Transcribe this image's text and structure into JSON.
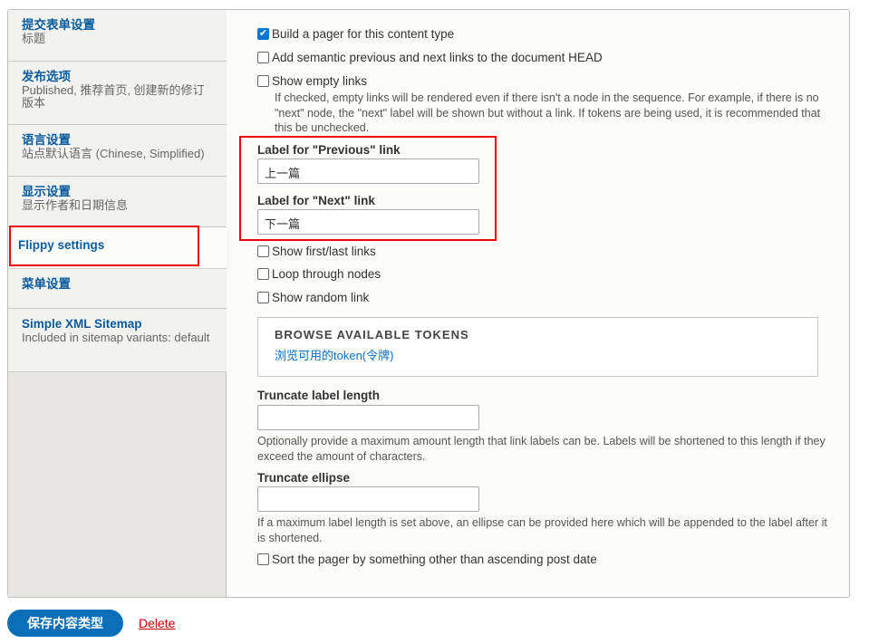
{
  "sidebar": {
    "tabs": [
      {
        "title": "提交表单设置",
        "summary": "标题"
      },
      {
        "title": "发布选项",
        "summary": "Published, 推荐首页, 创建新的修订版本"
      },
      {
        "title": "语言设置",
        "summary": "站点默认语言 (Chinese, Simplified)"
      },
      {
        "title": "显示设置",
        "summary": "显示作者和日期信息"
      },
      {
        "title": "Flippy settings",
        "summary": ""
      },
      {
        "title": "菜单设置",
        "summary": ""
      },
      {
        "title": "Simple XML Sitemap",
        "summary": "Included in sitemap variants: default"
      }
    ]
  },
  "main": {
    "build_pager": {
      "label": "Build a pager for this content type",
      "checked": true
    },
    "semantic_links": {
      "label": "Add semantic previous and next links to the document HEAD",
      "checked": false
    },
    "show_empty": {
      "label": "Show empty links",
      "checked": false,
      "description": "If checked, empty links will be rendered even if there isn't a node in the sequence. For example, if there is no \"next\" node, the \"next\" label will be shown but without a link. If tokens are being used, it is recommended that this be unchecked."
    },
    "prev_label": {
      "label": "Label for \"Previous\" link",
      "value": "上一篇"
    },
    "next_label": {
      "label": "Label for \"Next\" link",
      "value": "下一篇"
    },
    "first_last": {
      "label": "Show first/last links",
      "checked": false
    },
    "loop": {
      "label": "Loop through nodes",
      "checked": false
    },
    "random": {
      "label": "Show random link",
      "checked": false
    },
    "tokens": {
      "heading": "BROWSE AVAILABLE TOKENS",
      "link": "浏览可用的token(令牌)"
    },
    "truncate_length": {
      "label": "Truncate label length",
      "value": "",
      "description": "Optionally provide a maximum amount length that link labels can be. Labels will be shortened to this length if they exceed the amount of characters."
    },
    "truncate_ellipse": {
      "label": "Truncate ellipse",
      "value": "",
      "description": "If a maximum label length is set above, an ellipse can be provided here which will be appended to the label after it is shortened."
    },
    "sort": {
      "label": "Sort the pager by something other than ascending post date",
      "checked": false
    }
  },
  "actions": {
    "save": "保存内容类型",
    "delete": "Delete"
  },
  "colors": {
    "accent": "#0a6eb8",
    "highlight": "#e00000",
    "delete": "#cc0000"
  }
}
